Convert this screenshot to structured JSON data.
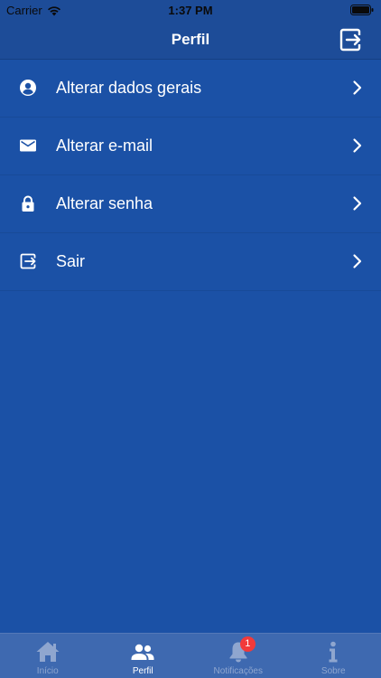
{
  "status_bar": {
    "carrier": "Carrier",
    "time": "1:37 PM"
  },
  "header": {
    "title": "Perfil"
  },
  "menu": {
    "items": [
      {
        "label": "Alterar dados gerais",
        "icon": "account-circle-icon"
      },
      {
        "label": "Alterar e-mail",
        "icon": "email-icon"
      },
      {
        "label": "Alterar senha",
        "icon": "lock-icon"
      },
      {
        "label": "Sair",
        "icon": "logout-icon"
      }
    ]
  },
  "tabs": [
    {
      "label": "Início",
      "icon": "home-icon",
      "active": false
    },
    {
      "label": "Perfil",
      "icon": "people-icon",
      "active": true
    },
    {
      "label": "Notificações",
      "icon": "bell-icon",
      "active": false,
      "badge": "1"
    },
    {
      "label": "Sobre",
      "icon": "info-icon",
      "active": false
    }
  ],
  "colors": {
    "background": "#1b51a6",
    "header": "#1d4c98",
    "tab_bar": "#3e69b0",
    "badge": "#f23a3a"
  }
}
